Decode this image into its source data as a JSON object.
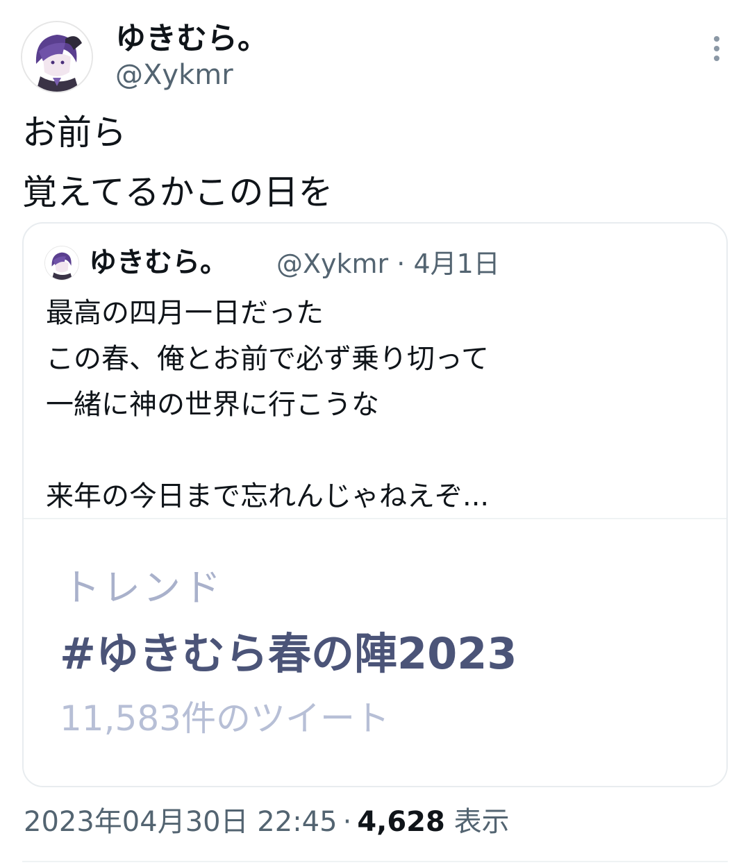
{
  "author": {
    "display_name": "ゆきむら。",
    "handle": "@Xykmr"
  },
  "tweet": {
    "lines": [
      "お前ら",
      "覚えてるかこの日を"
    ]
  },
  "quoted_tweet": {
    "display_name": "ゆきむら。",
    "handle": "@Xykmr",
    "separator": "·",
    "date": "4月1日",
    "lines": [
      "最高の四月一日だった",
      "この春、俺とお前で必ず乗り切って",
      "一緒に神の世界に行こうな",
      "",
      "来年の今日まで忘れんじゃねえぞ..."
    ],
    "media": {
      "label": "トレンド",
      "hashtag": "#ゆきむら春の陣2023",
      "count": "11,583件のツイート"
    }
  },
  "meta": {
    "timestamp": "2023年04月30日 22:45",
    "separator": "·",
    "views_count": "4,628",
    "views_label": "表示"
  },
  "icons": {
    "avatar": "avatar-image-icon",
    "more": "more-vertical-icon"
  },
  "colors": {
    "text_primary": "#0f1419",
    "text_secondary": "#536471",
    "trend_label": "#a9b1cb",
    "trend_hashtag": "#4b5478",
    "avatar_hair": "#5a3f8f"
  }
}
